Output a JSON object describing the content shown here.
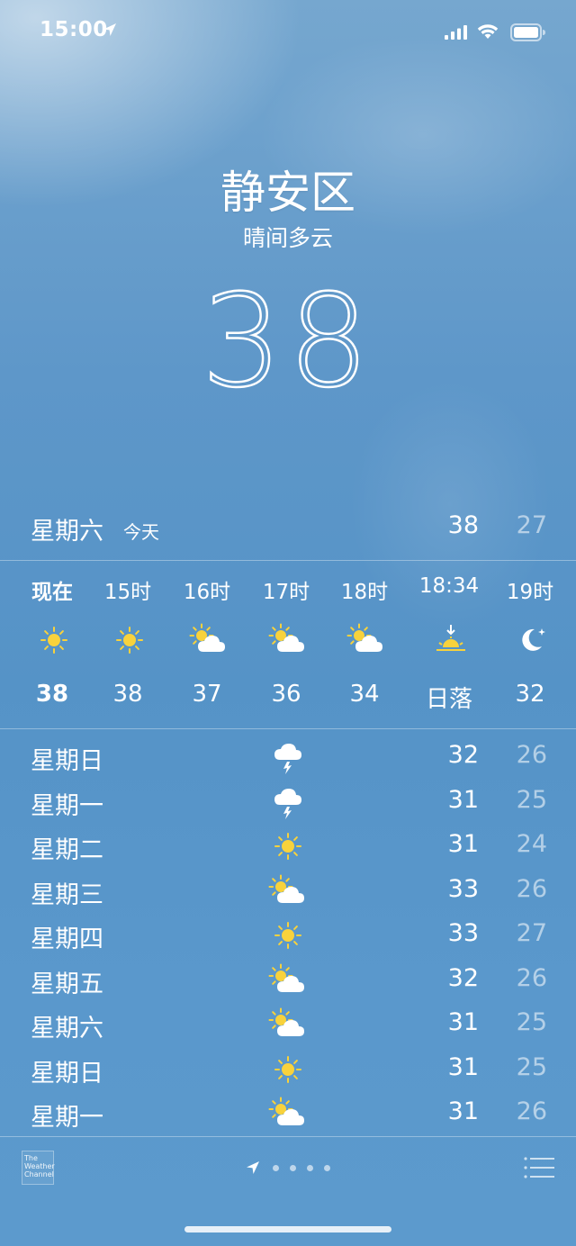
{
  "status": {
    "time": "15:00"
  },
  "location": {
    "city": "静安区",
    "condition": "晴间多云",
    "temperature": "38"
  },
  "today": {
    "day": "星期六",
    "tag": "今天",
    "high": "38",
    "low": "27"
  },
  "hourly": [
    {
      "time": "现在",
      "icon": "sun-icon",
      "value": "38"
    },
    {
      "time": "15时",
      "icon": "sun-icon",
      "value": "38"
    },
    {
      "time": "16时",
      "icon": "partly-cloudy-icon",
      "value": "37"
    },
    {
      "time": "17时",
      "icon": "partly-cloudy-icon",
      "value": "36"
    },
    {
      "time": "18时",
      "icon": "partly-cloudy-icon",
      "value": "34"
    },
    {
      "time": "18:34",
      "icon": "sunset-icon",
      "value": "日落"
    },
    {
      "time": "19时",
      "icon": "moon-icon",
      "value": "32"
    }
  ],
  "daily": [
    {
      "day": "星期日",
      "icon": "thunderstorm-icon",
      "high": "32",
      "low": "26"
    },
    {
      "day": "星期一",
      "icon": "thunderstorm-icon",
      "high": "31",
      "low": "25"
    },
    {
      "day": "星期二",
      "icon": "sun-icon",
      "high": "31",
      "low": "24"
    },
    {
      "day": "星期三",
      "icon": "partly-cloudy-icon",
      "high": "33",
      "low": "26"
    },
    {
      "day": "星期四",
      "icon": "sun-icon",
      "high": "33",
      "low": "27"
    },
    {
      "day": "星期五",
      "icon": "partly-cloudy-icon",
      "high": "32",
      "low": "26"
    },
    {
      "day": "星期六",
      "icon": "partly-cloudy-icon",
      "high": "31",
      "low": "25"
    },
    {
      "day": "星期日",
      "icon": "sun-icon",
      "high": "31",
      "low": "25"
    },
    {
      "day": "星期一",
      "icon": "partly-cloudy-icon",
      "high": "31",
      "low": "26"
    }
  ],
  "footer": {
    "logo_lines": [
      "The",
      "Weather",
      "Channel"
    ],
    "page_count": 4
  },
  "colors": {
    "sun": "#f8d23c",
    "cloud": "#ffffff",
    "low_temp": "rgba(255,255,255,0.55)"
  }
}
